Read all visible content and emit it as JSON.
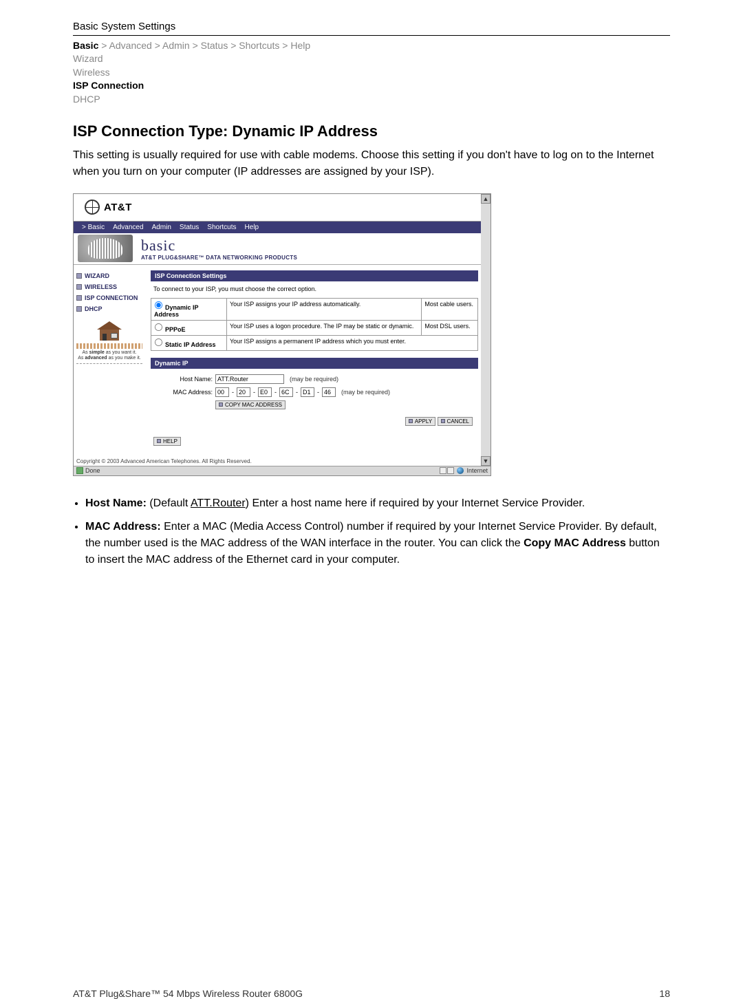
{
  "header": {
    "title": "Basic System Settings"
  },
  "breadcrumb": {
    "basic": "Basic",
    "rest": " > Advanced > Admin > Status > Shortcuts > Help"
  },
  "leftnav": {
    "wizard": "Wizard",
    "wireless": "Wireless",
    "isp": "ISP Connection",
    "dhcp": "DHCP"
  },
  "heading": "ISP Connection Type: Dynamic IP Address",
  "intro": "This setting is usually required for use with cable modems. Choose this setting if you don't have to log on to the Internet when you turn on your computer (IP addresses are assigned by your ISP).",
  "shot": {
    "brand": "AT&T",
    "topnav": [
      "> Basic",
      "Advanced",
      "Admin",
      "Status",
      "Shortcuts",
      "Help"
    ],
    "banner": {
      "big": "basic",
      "small": "AT&T PLUG&SHARE™ DATA NETWORKING PRODUCTS"
    },
    "sidemenu": [
      "WIZARD",
      "WIRELESS",
      "ISP CONNECTION",
      "DHCP"
    ],
    "promo1a": "As ",
    "promo1b": "simple",
    "promo1c": " as you want it.",
    "promo2a": "As ",
    "promo2b": "advanced",
    "promo2c": " as you make it.",
    "panel_header": "ISP Connection Settings",
    "panel_text": "To connect to your ISP, you must choose the correct option.",
    "options": [
      {
        "label": "Dynamic IP Address",
        "desc": "Your ISP assigns your IP address automatically.",
        "note": "Most cable users."
      },
      {
        "label": "PPPoE",
        "desc": "Your ISP uses a logon procedure. The IP may be static or dynamic.",
        "note": "Most DSL users."
      },
      {
        "label": "Static IP Address",
        "desc": "Your ISP assigns a permanent IP address which you must enter.",
        "note": ""
      }
    ],
    "sub_header": "Dynamic IP",
    "form": {
      "host_label": "Host Name:",
      "host_value": "ATT.Router",
      "host_hint": "(may be required)",
      "mac_label": "MAC Address:",
      "mac": [
        "00",
        "20",
        "E0",
        "6C",
        "D1",
        "46"
      ],
      "mac_hint": "(may be required)",
      "copy_btn": "COPY MAC ADDRESS",
      "apply": "APPLY",
      "cancel": "CANCEL",
      "help": "HELP"
    },
    "copyright": "Copyright © 2003 Advanced American Telephones. All Rights Reserved.",
    "status": {
      "done": "Done",
      "internet": "Internet"
    }
  },
  "bullets": {
    "b1_label": "Host Name:",
    "b1_default_label": " (Default ",
    "b1_default_value": "ATT.Router",
    "b1_rest": ") Enter a host name here if required by your Internet Service Provider.",
    "b2_label": "MAC Address:",
    "b2_text": " Enter a MAC (Media Access Control) number if required by your Internet Service Provider. By default, the number used is the MAC address of the WAN interface in the router. You can click the ",
    "b2_button": "Copy MAC Address",
    "b2_rest": " button to insert the MAC address of the Ethernet card in your computer."
  },
  "footer": {
    "left": "AT&T Plug&Share™ 54 Mbps Wireless Router 6800G",
    "right": "18"
  }
}
